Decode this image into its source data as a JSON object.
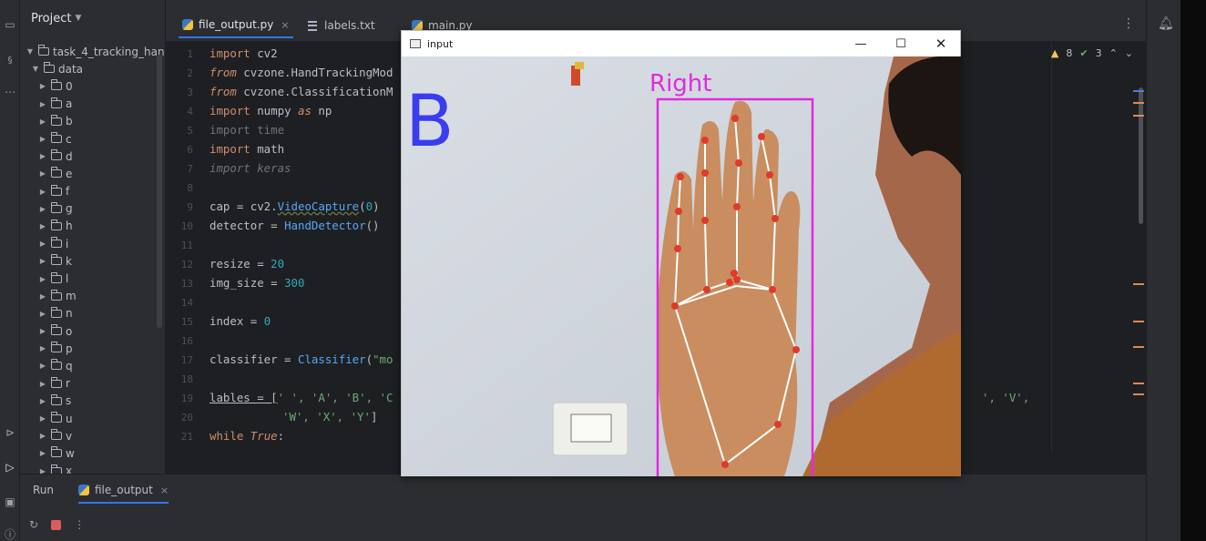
{
  "project": {
    "title": "Project",
    "root": "task_4_tracking_han",
    "data_folder": "data",
    "folders": [
      "0",
      "a",
      "b",
      "c",
      "d",
      "e",
      "f",
      "g",
      "h",
      "i",
      "k",
      "l",
      "m",
      "n",
      "o",
      "p",
      "q",
      "r",
      "s",
      "u",
      "v",
      "w",
      "x"
    ]
  },
  "tabs": [
    {
      "label": "file_output.py",
      "close": "×"
    },
    {
      "label": "labels.txt"
    },
    {
      "label": "main.py"
    }
  ],
  "inspections": {
    "warnings": "8",
    "ok": "3"
  },
  "line_numbers": [
    "1",
    "2",
    "3",
    "4",
    "5",
    "6",
    "7",
    "8",
    "9",
    "10",
    "11",
    "12",
    "13",
    "14",
    "15",
    "16",
    "17",
    "18",
    "19",
    "20",
    "21"
  ],
  "code": {
    "l1_kw": "import",
    "l1_rest": " cv2",
    "l2_kw": "from",
    "l2_rest": " cvzone.HandTrackingMod",
    "l3_kw": "from",
    "l3_rest": " cvzone.ClassificationM",
    "l4_kw": "import",
    "l4_mid": " numpy ",
    "l4_as": "as",
    "l4_end": " np",
    "l5": "import time",
    "l6_kw": "import",
    "l6_rest": " math",
    "l7": "import keras",
    "l9_a": "cap = cv2.",
    "l9_fn": "VideoCapture",
    "l9_b": "(",
    "l9_num": "0",
    "l9_c": ")",
    "l10_a": "detector = ",
    "l10_fn": "HandDetector",
    "l10_b": "()",
    "l12_a": "resize = ",
    "l12_num": "20",
    "l13_a": "img_size = ",
    "l13_num": "300",
    "l15_a": "index = ",
    "l15_num": "0",
    "l17_a": "classifier = ",
    "l17_fn": "Classifier",
    "l17_b": "(",
    "l17_str": "\"mo",
    "l19_a": "lables = [",
    "l19_str": "' ', 'A', 'B', 'C",
    "l19_tail": "', 'V',",
    "l20_str": "'W', 'X', 'Y'",
    "l20_b": "]",
    "l21_kw": "while",
    "l21_true": " True",
    "l21_c": ":"
  },
  "run": {
    "run_label": "Run",
    "tab_label": "file_output",
    "close": "×"
  },
  "cv_window": {
    "title": "input",
    "predicted_letter": "B",
    "hand_label": "Right",
    "letter_color": "#3a3cf0",
    "box_color": "#e02adf"
  }
}
